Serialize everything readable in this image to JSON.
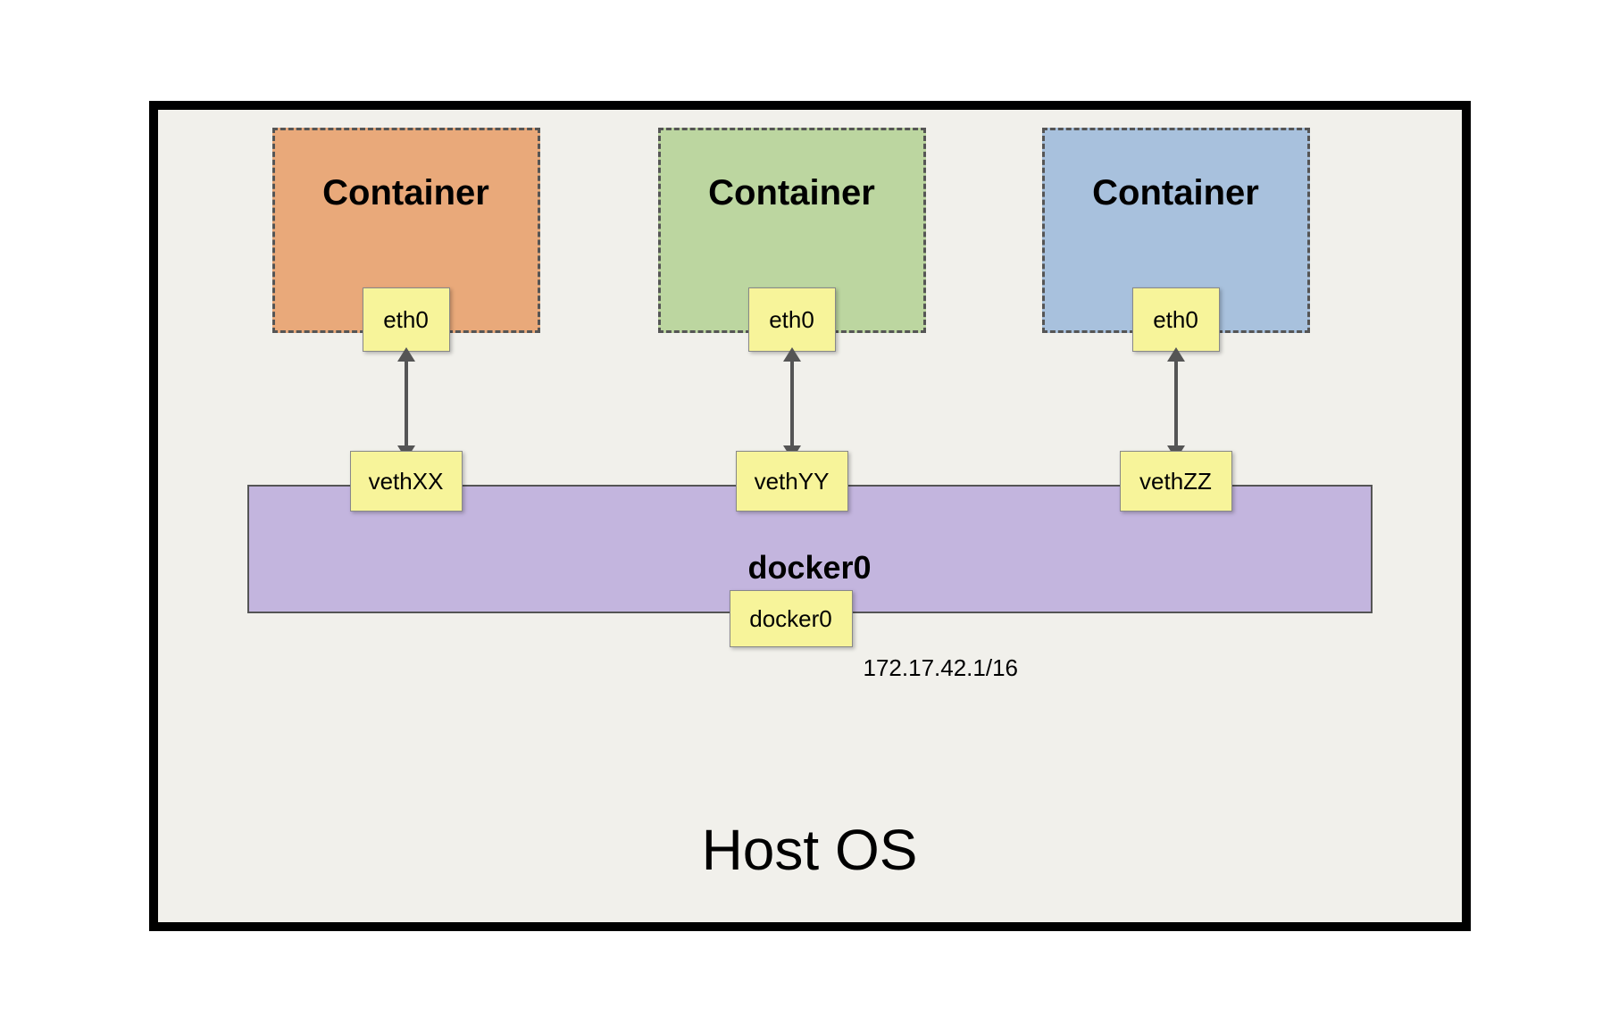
{
  "host": {
    "title": "Host OS"
  },
  "containers": [
    {
      "title": "Container",
      "eth": "eth0",
      "color": "#e9a97a"
    },
    {
      "title": "Container",
      "eth": "eth0",
      "color": "#bcd6a0"
    },
    {
      "title": "Container",
      "eth": "eth0",
      "color": "#a8c1dd"
    }
  ],
  "veths": [
    {
      "label": "vethXX"
    },
    {
      "label": "vethYY"
    },
    {
      "label": "vethZZ"
    }
  ],
  "bridge": {
    "title": "docker0",
    "iface": "docker0",
    "ip": "172.17.42.1/16"
  }
}
